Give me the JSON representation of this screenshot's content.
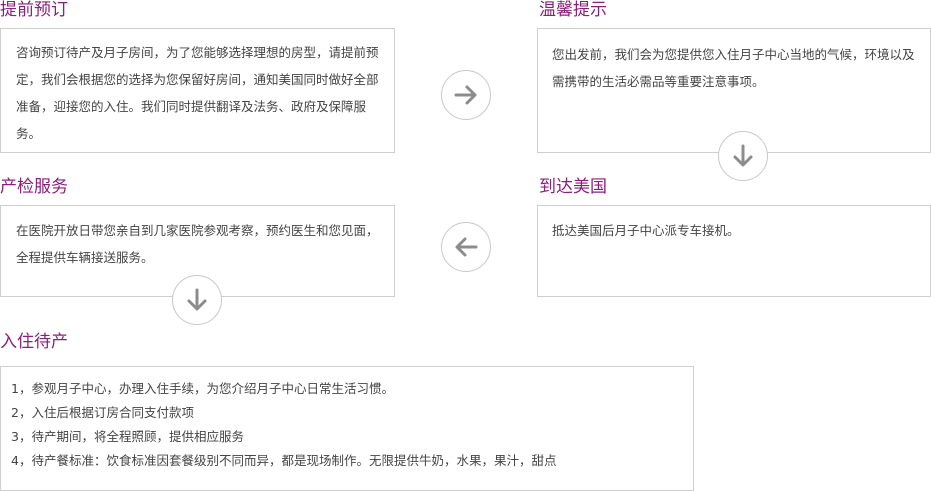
{
  "sections": {
    "booking": {
      "title": "提前预订",
      "text": "咨询预订待产及月子房间，为了您能够选择理想的房型，请提前预定，我们会根据您的选择为您保留好房间，通知美国同时做好全部准备，迎接您的入住。我们同时提供翻译及法务、政府及保障服务。"
    },
    "reminder": {
      "title": "温馨提示",
      "text": "您出发前，我们会为您提供您入住月子中心当地的气候，环境以及需携带的生活必需品等重要注意事项。"
    },
    "arrival": {
      "title": "到达美国",
      "text": "抵达美国后月子中心派专车接机。"
    },
    "checkup": {
      "title": "产检服务",
      "text": "在医院开放日带您亲自到几家医院参观考察，预约医生和您见面，全程提供车辆接送服务。"
    },
    "stay": {
      "title": "入住待产",
      "steps": [
        "1，参观月子中心，办理入住手续，为您介绍月子中心日常生活习惯。",
        "2，入住后根据订房合同支付款项",
        "3，待产期间，将全程照顾，提供相应服务",
        "4，待产餐标准：饮食标准因套餐级别不同而异，都是现场制作。无限提供牛奶，水果，果汁，甜点"
      ]
    }
  },
  "icons": {
    "arrow_right": "arrow-right-icon",
    "arrow_down": "arrow-down-icon",
    "arrow_left": "arrow-left-icon"
  },
  "colors": {
    "title": "#8a1f7c",
    "text": "#444444",
    "border": "#cfcfcf",
    "arrow": "#8c8c8c"
  }
}
